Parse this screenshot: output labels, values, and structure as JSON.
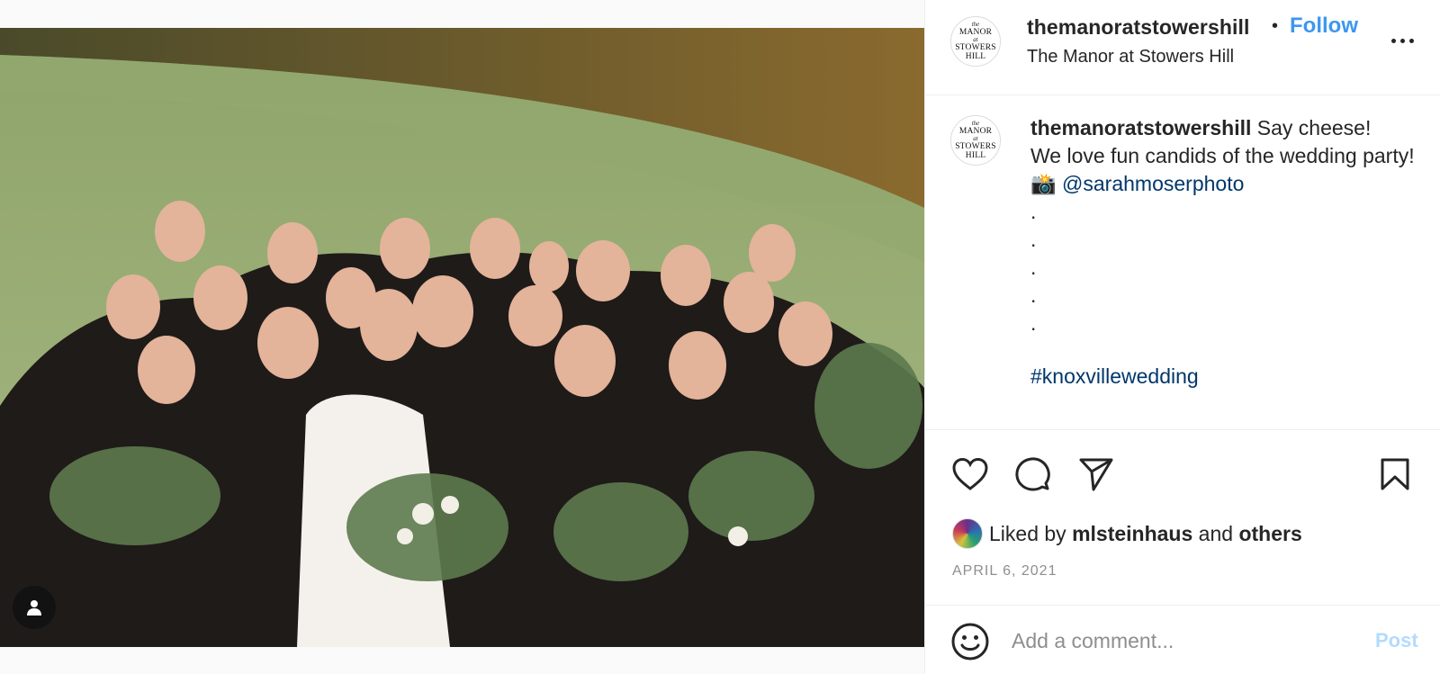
{
  "post": {
    "username": "themanoratstowershill",
    "separator": "•",
    "follow_label": "Follow",
    "location": "The Manor at Stowers Hill",
    "avatar_text": {
      "the": "the",
      "line1": "MANOR",
      "of": "at",
      "line2": "STOWERS",
      "line3": "HILL"
    }
  },
  "caption": {
    "username": "themanoratstowershill",
    "text_line1": "Say cheese!",
    "text_line2": "We love fun candids of the wedding party!",
    "camera_emoji": "📸",
    "mention": "@sarahmoserphoto",
    "dots": [
      ".",
      ".",
      ".",
      ".",
      "."
    ],
    "hashtag": "#knoxvillewedding"
  },
  "likes": {
    "prefix": "Liked by",
    "user": "mlsteinhaus",
    "conjunction": "and",
    "others": "others"
  },
  "date": "APRIL 6, 2021",
  "comment": {
    "placeholder": "Add a comment...",
    "post_label": "Post"
  },
  "icons": {
    "like": "heart-icon",
    "comment": "comment-bubble-icon",
    "share": "paper-plane-icon",
    "save": "bookmark-icon",
    "more": "more-horizontal-icon",
    "tag": "person-tag-icon",
    "emoji": "smiley-icon"
  },
  "colors": {
    "follow": "#3d97f0",
    "link": "#00376b",
    "muted": "#8e8e8e",
    "post_disabled": "#b3dbff"
  }
}
